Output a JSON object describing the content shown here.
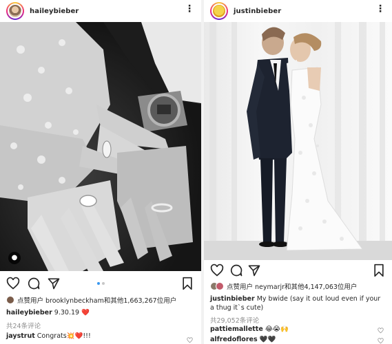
{
  "left_post": {
    "username": "haileybieber",
    "liked_by": "点赞用户  brooklynbeckham和其他1,663,267位用户",
    "caption_user": "haileybieber",
    "caption_text": "9.30.19",
    "caption_emoji": "❤️",
    "comments_link": "共24条评论",
    "comment_user": "jaystrut",
    "comment_text": "Congrats💥❤️!!!"
  },
  "right_post": {
    "username": "justinbieber",
    "liked_by": "点赞用户  neymarjr和其他4,147,063位用户",
    "caption_user": "justinbieber",
    "caption_text": "My bwide (say it out loud even if your a thug it`s cute)",
    "comments_link": "共29,052条评论",
    "comments": [
      {
        "user": "pattiemallette",
        "text": "😂😭🙌"
      },
      {
        "user": "alfredoflores",
        "text": "🖤🖤"
      }
    ]
  },
  "colors": {
    "like_red": "#ed4956",
    "carousel_active": "#3897f0",
    "text": "#262626",
    "muted": "#8e8e8e"
  },
  "icons": [
    "more-icon",
    "heart-icon",
    "comment-icon",
    "share-icon",
    "bookmark-icon",
    "user-tag-icon"
  ]
}
